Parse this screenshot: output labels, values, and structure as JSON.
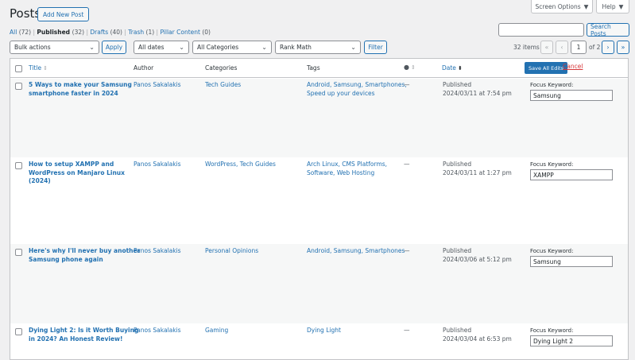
{
  "screen_meta": {
    "screen_options": "Screen Options",
    "help": "Help"
  },
  "header": {
    "title": "Posts",
    "add_new": "Add New Post"
  },
  "views": [
    {
      "label": "All",
      "count": "(72)"
    },
    {
      "label": "Published",
      "count": "(32)"
    },
    {
      "label": "Drafts",
      "count": "(40)"
    },
    {
      "label": "Trash",
      "count": "(1)"
    },
    {
      "label": "Pillar Content",
      "count": "(0)"
    }
  ],
  "search": {
    "value": "",
    "button": "Search Posts"
  },
  "filters": {
    "bulk_actions": "Bulk actions",
    "apply": "Apply",
    "dates": "All dates",
    "categories": "All Categories",
    "seo": "Rank Math",
    "filter": "Filter"
  },
  "pagination": {
    "items": "32 items",
    "first": "«",
    "prev": "‹",
    "current": "1",
    "of_total": "of 2",
    "next": "›",
    "last": "»"
  },
  "table": {
    "headers": {
      "title": "Title",
      "author": "Author",
      "categories": "Categories",
      "tags": "Tags",
      "date": "Date"
    },
    "icons": {
      "sort": "sort-arrows-icon",
      "comments": "comment-bubble-icon"
    },
    "save_all": "Save All Edits",
    "cancel": "Cancel",
    "rows": [
      {
        "title_lines": [
          "5 Ways to make your Samsung",
          "smartphone faster in 2024"
        ],
        "author": "Panos Sakalakis",
        "categories": "Tech Guides",
        "tags_lines": [
          "Android, Samsung, Smartphones,",
          "Speed up your devices"
        ],
        "comments": "—",
        "status": "Published",
        "date": "2024/03/11 at 7:54 pm",
        "fk_label": "Focus Keyword:",
        "fk_value": "Samsung"
      },
      {
        "title_lines": [
          "How to setup XAMPP and",
          "WordPress on Manjaro Linux",
          "(2024)"
        ],
        "author": "Panos Sakalakis",
        "categories": "WordPress, Tech Guides",
        "tags_lines": [
          "Arch Linux, CMS Platforms,",
          "Software, Web Hosting"
        ],
        "comments": "—",
        "status": "Published",
        "date": "2024/03/11 at 1:27 pm",
        "fk_label": "Focus Keyword:",
        "fk_value": "XAMPP"
      },
      {
        "title_lines": [
          "Here's why I'll never buy another",
          "Samsung phone again"
        ],
        "author": "Panos Sakalakis",
        "categories": "Personal Opinions",
        "tags_lines": [
          "Android, Samsung, Smartphones"
        ],
        "comments": "—",
        "status": "Published",
        "date": "2024/03/06 at 5:12 pm",
        "fk_label": "Focus Keyword:",
        "fk_value": "Samsung"
      },
      {
        "title_lines": [
          "Dying Light 2: Is it Worth Buying",
          "in 2024? An Honest Review!"
        ],
        "author": "Panos Sakalakis",
        "categories": "Gaming",
        "tags_lines": [
          "Dying Light"
        ],
        "comments": "—",
        "status": "Published",
        "date": "2024/03/04 at 6:53 pm",
        "fk_label": "Focus Keyword:",
        "fk_value": "Dying Light 2"
      }
    ]
  }
}
